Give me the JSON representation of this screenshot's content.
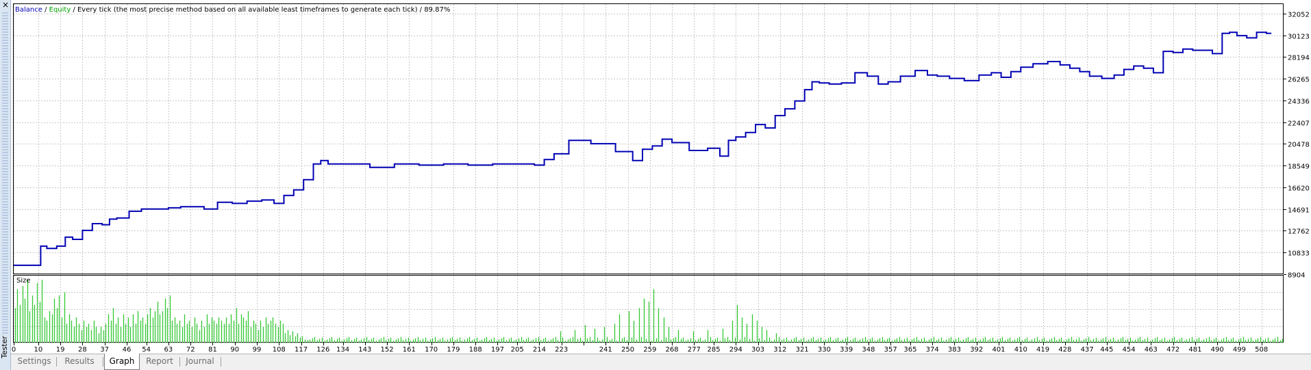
{
  "window": {
    "panel_title": "Tester",
    "close_glyph": "×"
  },
  "header": {
    "balance_label": "Balance",
    "sep1": " / ",
    "equity_label": "Equity",
    "description": " / Every tick (the most precise method based on all available least timeframes to generate each tick) / 89.87%"
  },
  "colors": {
    "balance": "#0000b4",
    "equity": "#00a000",
    "volume": "#32c832",
    "grid": "#c8c8c8"
  },
  "volume_panel": {
    "label": "Size"
  },
  "tabs": [
    {
      "label": "Settings",
      "active": false
    },
    {
      "label": "Results",
      "active": false
    },
    {
      "label": "Graph",
      "active": true
    },
    {
      "label": "Report",
      "active": false
    },
    {
      "label": "Journal",
      "active": false
    }
  ],
  "chart_data": {
    "type": "line",
    "series": [
      {
        "name": "Balance",
        "x": [
          0,
          10,
          12,
          15,
          20,
          22,
          26,
          30,
          34,
          38,
          40,
          44,
          50,
          54,
          60,
          66,
          70,
          75,
          80,
          86,
          92,
          98,
          104,
          108,
          112,
          116,
          120,
          124,
          126,
          130,
          140,
          150,
          160,
          170,
          180,
          190,
          200,
          210,
          214,
          218,
          222,
          230,
          240,
          250,
          254,
          258,
          262,
          266,
          270,
          280,
          285,
          290,
          292,
          296,
          300,
          304,
          308,
          312,
          316,
          320,
          324,
          326,
          330,
          334,
          340,
          345,
          350,
          354,
          358,
          364,
          370,
          374,
          378,
          384,
          390,
          396,
          400,
          404,
          408,
          412,
          418,
          424,
          428,
          432,
          436,
          440,
          446,
          450,
          454,
          458,
          462,
          466,
          470,
          474,
          478,
          482,
          486,
          490,
          494,
          496,
          500,
          504,
          508,
          512
        ],
        "y": [
          9700,
          9700,
          11400,
          11200,
          11400,
          12200,
          12000,
          12800,
          13400,
          13300,
          13800,
          13900,
          14500,
          14700,
          14700,
          14800,
          14900,
          14900,
          14700,
          15300,
          15200,
          15400,
          15500,
          15200,
          15900,
          16400,
          17300,
          18700,
          19000,
          18700,
          18700,
          18400,
          18700,
          18600,
          18700,
          18600,
          18700,
          18700,
          18600,
          19100,
          19600,
          20800,
          20500,
          19800,
          19000,
          20000,
          20300,
          20900,
          20600,
          19900,
          20100,
          19400,
          20800,
          21100,
          21500,
          22200,
          21900,
          23000,
          23600,
          24300,
          25300,
          26000,
          25900,
          25800,
          25900,
          26800,
          26500,
          25800,
          26000,
          26500,
          27000,
          26600,
          26500,
          26300,
          26100,
          26600,
          26800,
          26400,
          26900,
          27300,
          27600,
          27800,
          27500,
          27200,
          26900,
          26500,
          26300,
          26600,
          27100,
          27400,
          27200,
          26800,
          28700,
          28600,
          28900,
          28800,
          28800,
          28500,
          30300,
          30400,
          30100,
          29900,
          30400,
          30300
        ]
      }
    ],
    "y_ticks": [
      32052,
      30123,
      28194,
      26265,
      24336,
      22407,
      20478,
      18549,
      16620,
      14691,
      12762,
      10833,
      8904
    ],
    "x_ticks": [
      0,
      10,
      19,
      28,
      37,
      46,
      54,
      63,
      72,
      81,
      90,
      99,
      108,
      117,
      126,
      134,
      143,
      152,
      161,
      170,
      179,
      188,
      197,
      205,
      214,
      223,
      232,
      241,
      250,
      259,
      268,
      277,
      285,
      294,
      303,
      312,
      321,
      330,
      339,
      348,
      357,
      365,
      374,
      383,
      392,
      401,
      410,
      419,
      428,
      437,
      445,
      454,
      463,
      472,
      481,
      490,
      499,
      508
    ],
    "x_labels": [
      "0",
      "10",
      "19",
      "28",
      "37",
      "46",
      "54",
      "63",
      "72",
      "81",
      "90",
      "99",
      "108",
      "117",
      "126",
      "134",
      "143",
      "152",
      "161",
      "170",
      "179",
      "188",
      "197",
      "205",
      "214",
      "223",
      "241",
      "250",
      "259",
      "268",
      "277",
      "285",
      "294",
      "303",
      "312",
      "321",
      "330",
      "339",
      "348",
      "357",
      "365",
      "374",
      "383",
      "392",
      "401",
      "410",
      "419",
      "428",
      "437",
      "445",
      "454",
      "463",
      "472",
      "481",
      "490",
      "499",
      "508"
    ],
    "xlim": [
      0,
      517
    ],
    "ylim": [
      8904,
      32900
    ],
    "volume_profile": [
      [
        0,
        0.55
      ],
      [
        1,
        0.85
      ],
      [
        2,
        0.6
      ],
      [
        3,
        0.9
      ],
      [
        4,
        0.7
      ],
      [
        5,
        1.0
      ],
      [
        6,
        0.5
      ],
      [
        7,
        0.75
      ],
      [
        8,
        0.6
      ],
      [
        9,
        0.95
      ],
      [
        10,
        0.65
      ],
      [
        11,
        1.0
      ],
      [
        12,
        0.4
      ],
      [
        13,
        0.35
      ],
      [
        14,
        0.5
      ],
      [
        15,
        0.45
      ],
      [
        16,
        0.7
      ],
      [
        17,
        0.55
      ],
      [
        18,
        0.75
      ],
      [
        19,
        0.4
      ],
      [
        20,
        0.8
      ],
      [
        21,
        0.3
      ],
      [
        22,
        0.45
      ],
      [
        23,
        0.35
      ],
      [
        24,
        0.25
      ],
      [
        25,
        0.4
      ],
      [
        26,
        0.3
      ],
      [
        27,
        0.2
      ],
      [
        28,
        0.35
      ],
      [
        29,
        0.25
      ],
      [
        30,
        0.3
      ],
      [
        31,
        0.2
      ],
      [
        32,
        0.35
      ],
      [
        33,
        0.25
      ],
      [
        34,
        0.15
      ],
      [
        35,
        0.25
      ],
      [
        36,
        0.2
      ],
      [
        37,
        0.3
      ],
      [
        38,
        0.45
      ],
      [
        39,
        0.35
      ],
      [
        40,
        0.55
      ],
      [
        41,
        0.3
      ],
      [
        42,
        0.4
      ],
      [
        43,
        0.25
      ],
      [
        44,
        0.45
      ],
      [
        45,
        0.3
      ],
      [
        46,
        0.4
      ],
      [
        47,
        0.25
      ],
      [
        48,
        0.45
      ],
      [
        49,
        0.3
      ],
      [
        50,
        0.5
      ],
      [
        51,
        0.35
      ],
      [
        52,
        0.4
      ],
      [
        53,
        0.3
      ],
      [
        54,
        0.45
      ],
      [
        55,
        0.55
      ],
      [
        56,
        0.4
      ],
      [
        57,
        0.5
      ],
      [
        58,
        0.65
      ],
      [
        59,
        0.45
      ],
      [
        60,
        0.5
      ],
      [
        61,
        0.7
      ],
      [
        62,
        0.55
      ],
      [
        63,
        0.75
      ],
      [
        64,
        0.35
      ],
      [
        65,
        0.4
      ],
      [
        66,
        0.3
      ],
      [
        67,
        0.35
      ],
      [
        68,
        0.25
      ],
      [
        69,
        0.45
      ],
      [
        70,
        0.3
      ],
      [
        71,
        0.35
      ],
      [
        72,
        0.25
      ],
      [
        73,
        0.4
      ],
      [
        74,
        0.3
      ],
      [
        75,
        0.2
      ],
      [
        76,
        0.35
      ],
      [
        77,
        0.25
      ],
      [
        78,
        0.45
      ],
      [
        79,
        0.3
      ],
      [
        80,
        0.4
      ],
      [
        81,
        0.35
      ],
      [
        82,
        0.3
      ],
      [
        83,
        0.4
      ],
      [
        84,
        0.35
      ],
      [
        85,
        0.3
      ],
      [
        86,
        0.4
      ],
      [
        87,
        0.3
      ],
      [
        88,
        0.45
      ],
      [
        89,
        0.35
      ],
      [
        90,
        0.55
      ],
      [
        91,
        0.3
      ],
      [
        92,
        0.45
      ],
      [
        93,
        0.4
      ],
      [
        94,
        0.35
      ],
      [
        95,
        0.5
      ],
      [
        96,
        0.25
      ],
      [
        97,
        0.35
      ],
      [
        98,
        0.3
      ],
      [
        99,
        0.2
      ],
      [
        100,
        0.35
      ],
      [
        101,
        0.25
      ],
      [
        102,
        0.4
      ],
      [
        103,
        0.3
      ],
      [
        104,
        0.35
      ],
      [
        105,
        0.4
      ],
      [
        106,
        0.3
      ],
      [
        107,
        0.25
      ],
      [
        108,
        0.35
      ],
      [
        109,
        0.3
      ],
      [
        110,
        0.15
      ],
      [
        111,
        0.2
      ],
      [
        112,
        0.12
      ],
      [
        113,
        0.18
      ],
      [
        114,
        0.1
      ],
      [
        115,
        0.15
      ],
      [
        116,
        0.08
      ],
      [
        117,
        0.1
      ],
      [
        118,
        0.05
      ],
      [
        119,
        0.04
      ]
    ],
    "volume_spikes": [
      [
        222,
        0.18
      ],
      [
        228,
        0.2
      ],
      [
        232,
        0.28
      ],
      [
        236,
        0.22
      ],
      [
        240,
        0.25
      ],
      [
        244,
        0.3
      ],
      [
        246,
        0.45
      ],
      [
        250,
        0.5
      ],
      [
        252,
        0.35
      ],
      [
        254,
        0.55
      ],
      [
        256,
        0.7
      ],
      [
        258,
        0.65
      ],
      [
        260,
        0.85
      ],
      [
        262,
        0.55
      ],
      [
        264,
        0.4
      ],
      [
        266,
        0.25
      ],
      [
        270,
        0.2
      ],
      [
        276,
        0.18
      ],
      [
        282,
        0.2
      ],
      [
        288,
        0.22
      ],
      [
        292,
        0.35
      ],
      [
        294,
        0.6
      ],
      [
        296,
        0.4
      ],
      [
        298,
        0.3
      ],
      [
        300,
        0.45
      ],
      [
        302,
        0.35
      ],
      [
        304,
        0.25
      ],
      [
        306,
        0.2
      ],
      [
        310,
        0.15
      ]
    ]
  }
}
